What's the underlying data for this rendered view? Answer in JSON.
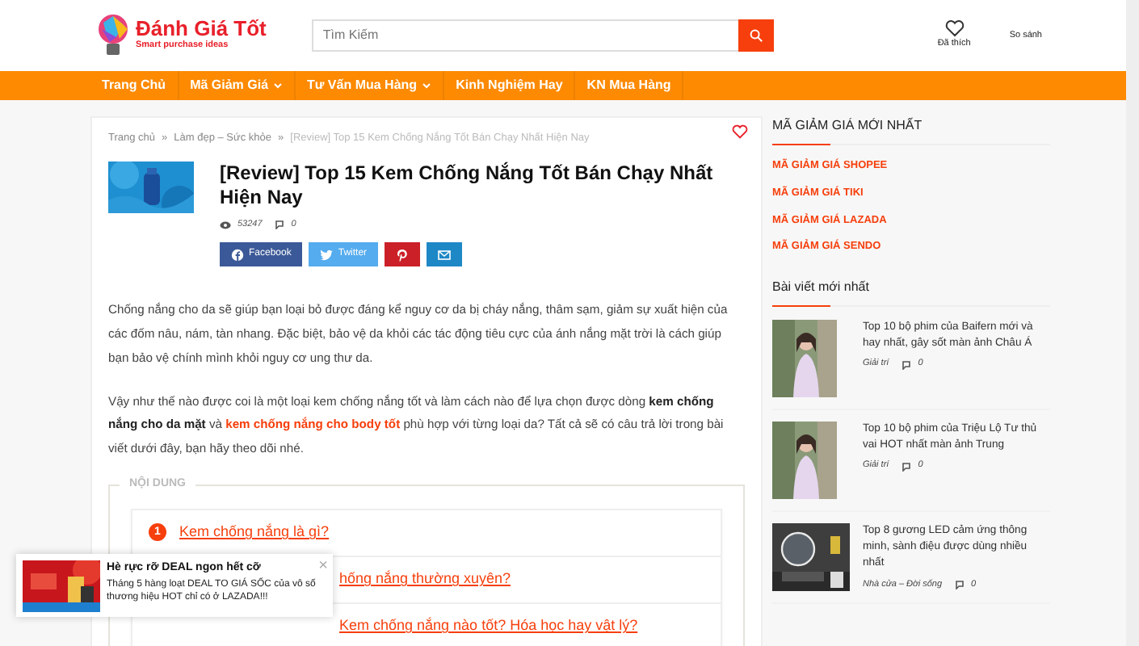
{
  "header": {
    "logo": {
      "title": "Đánh Giá Tốt",
      "tagline": "Smart purchase ideas"
    },
    "search": {
      "placeholder": "Tìm Kiếm"
    },
    "actions": [
      {
        "kind": "wishlist",
        "label": "Đã thích"
      },
      {
        "kind": "compare",
        "label": "So sánh"
      }
    ]
  },
  "nav": [
    {
      "label": "Trang Chủ",
      "dropdown": false
    },
    {
      "label": "Mã Giảm Giá",
      "dropdown": true
    },
    {
      "label": "Tư Vấn Mua Hàng",
      "dropdown": true
    },
    {
      "label": "Kinh Nghiệm Hay",
      "dropdown": false
    },
    {
      "label": "KN Mua Hàng",
      "dropdown": false
    }
  ],
  "article": {
    "breadcrumb_separator": "»",
    "breadcrumb": [
      {
        "label": "Trang chủ",
        "current": false
      },
      {
        "label": "Làm đẹp – Sức khỏe",
        "current": false
      },
      {
        "label": "[Review] Top 15 Kem Chống Nắng Tốt Bán Chạy Nhất Hiện Nay",
        "current": true
      }
    ],
    "title": "[Review] Top 15 Kem Chống Nắng Tốt Bán Chạy Nhất Hiện Nay",
    "views": "53247",
    "comments": "0",
    "share": [
      {
        "kind": "facebook",
        "label": "Facebook"
      },
      {
        "kind": "twitter",
        "label": "Twitter"
      },
      {
        "kind": "pinterest"
      },
      {
        "kind": "email"
      }
    ],
    "paragraphs": [
      [
        {
          "kind": "plain",
          "text": "Chống nắng cho da sẽ giúp bạn loại bỏ được đáng kể nguy cơ da bị cháy nắng, thâm sạm, giảm sự xuất hiện của các đốm nâu, nám, tàn nhang. Đặc biệt, bảo vệ da khỏi các tác động tiêu cực của ánh nắng mặt trời là cách giúp bạn bảo vệ chính mình khỏi nguy cơ ung thư da."
        }
      ],
      [
        {
          "kind": "plain",
          "text": "Vậy như thế nào được coi là một loại kem chống nắng tốt và làm cách nào để lựa chọn được dòng "
        },
        {
          "kind": "bold",
          "text": "kem chống nắng cho da mặt"
        },
        {
          "kind": "plain",
          "text": " và "
        },
        {
          "kind": "link",
          "text": "kem chống nắng cho body tốt"
        },
        {
          "kind": "plain",
          "text": " phù hợp với từng loại da? Tất cả sẽ có câu trả lời trong bài viết dưới đây, bạn hãy theo dõi nhé."
        }
      ]
    ],
    "toc": {
      "title": "NỘI DUNG",
      "items": [
        {
          "number": "1",
          "text": "Kem chống nắng là gì?"
        },
        {
          "text": "hống nắng thường xuyên?"
        },
        {
          "text": "Kem chống nắng nào tốt? Hóa học hay vật lý?"
        }
      ]
    }
  },
  "sidebar": {
    "coupons": {
      "title": "MÃ GIẢM GIÁ MỚI NHẤT",
      "items": [
        "MÃ GIẢM GIÁ SHOPEE",
        "MÃ GIẢM GIÁ TIKI",
        "MÃ GIẢM GIÁ LAZADA",
        "MÃ GIẢM GIÁ SENDO"
      ]
    },
    "latest": {
      "title": "Bài viết mới nhất",
      "posts": [
        {
          "title": "Top 10 bộ phim của Baifern mới và hay nhất, gây sốt màn ảnh Châu Á",
          "category": "Giải trí",
          "comments": "0",
          "kind": "person"
        },
        {
          "title": "Top 10 bộ phim của Triệu Lộ Tư thủ vai HOT nhất màn ảnh Trung",
          "category": "Giải trí",
          "comments": "0",
          "kind": "person"
        },
        {
          "title": "Top 8 gương LED cảm ứng thông minh, sành điệu được dùng nhiều nhất",
          "category": "Nhà cửa – Đời sống",
          "comments": "0",
          "kind": "room"
        }
      ]
    }
  },
  "popup": {
    "title": "Hè rực rỡ DEAL ngon hết cỡ",
    "text": "Tháng 5 hàng loạt DEAL TO GIÁ SỐC của vô số thương hiệu HOT chỉ có ở LAZADA!!!",
    "close": "×"
  }
}
